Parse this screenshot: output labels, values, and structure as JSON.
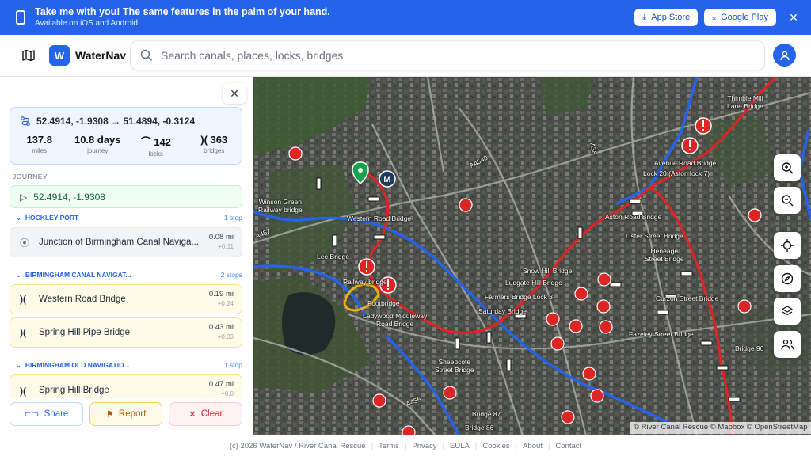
{
  "banner": {
    "title": "Take me with you! The same features in the palm of your hand.",
    "subtitle": "Available on iOS and Android",
    "app_store": "App Store",
    "google_play": "Google Play",
    "close": "✕"
  },
  "header": {
    "brand": "WaterNav",
    "logo_letter": "W",
    "search_placeholder": "Search canals, places, locks, bridges"
  },
  "journey": {
    "close": "✕",
    "route": "52.4914, -1.9308 → 51.4894, -0.3124",
    "stats": [
      {
        "value": "137.8",
        "label": "miles"
      },
      {
        "value": "10.8 days",
        "label": "journey"
      },
      {
        "value": "142",
        "label": "locks"
      },
      {
        "value": "363",
        "label": "bridges"
      }
    ],
    "section_label": "JOURNEY",
    "start": "52.4914, -1.9308",
    "groups": [
      {
        "name": "HOCKLEY PORT",
        "count": "1 stop"
      },
      {
        "name": "BIRMINGHAM CANAL NAVIGAT...",
        "count": "2 stops"
      },
      {
        "name": "BIRMINGHAM OLD NAVIGATIO...",
        "count": "1 stop"
      }
    ],
    "items": [
      {
        "label": "Junction of Birmingham Canal Naviga...",
        "dist": "0.08 mi",
        "delta": "+0.11"
      },
      {
        "label": "Western Road Bridge",
        "dist": "0.19 mi",
        "delta": "+0.24"
      },
      {
        "label": "Spring Hill Pipe Bridge",
        "dist": "0.43 mi",
        "delta": "+0.03"
      },
      {
        "label": "Spring Hill Bridge",
        "dist": "0.47 mi",
        "delta": "+0.0"
      }
    ],
    "actions": {
      "share": "Share",
      "report": "Report",
      "clear": "Clear"
    }
  },
  "map": {
    "labels": [
      "Winson Green Railway bridge",
      "Western Road Bridge",
      "Lee Bridge",
      "Railway bridge",
      "Footbridge",
      "Ladywood Middleway Road Bridge",
      "Sheepcote Street Bridge",
      "Bridge 87",
      "Bridge 86",
      "Snow Hill Bridge",
      "Ludgate Hill Bridge",
      "Farmers Bridge Lock 8",
      "Saturday Bridge",
      "Aston Road Bridge",
      "Lister Street Bridge",
      "Heneage Street Bridge",
      "Curzon Street Bridge",
      "Fazeley Street Bridge",
      "Avenue Road Bridge",
      "Lock 20 (Aston lock 7)",
      "Thimble Mill Lane Bridge",
      "Bridge 96",
      "A457",
      "A4540",
      "A456",
      "A38"
    ],
    "attribution": "© River Canal Rescue © Mapbox © OpenStreetMap",
    "route_color": "#dc2626",
    "canal_color": "#2563eb"
  },
  "footer": {
    "links": [
      "(c) 2026 WaterNav / River Canal Rescue",
      "Terms",
      "Privacy",
      "EULA",
      "Cookies",
      "About",
      "Contact"
    ]
  }
}
